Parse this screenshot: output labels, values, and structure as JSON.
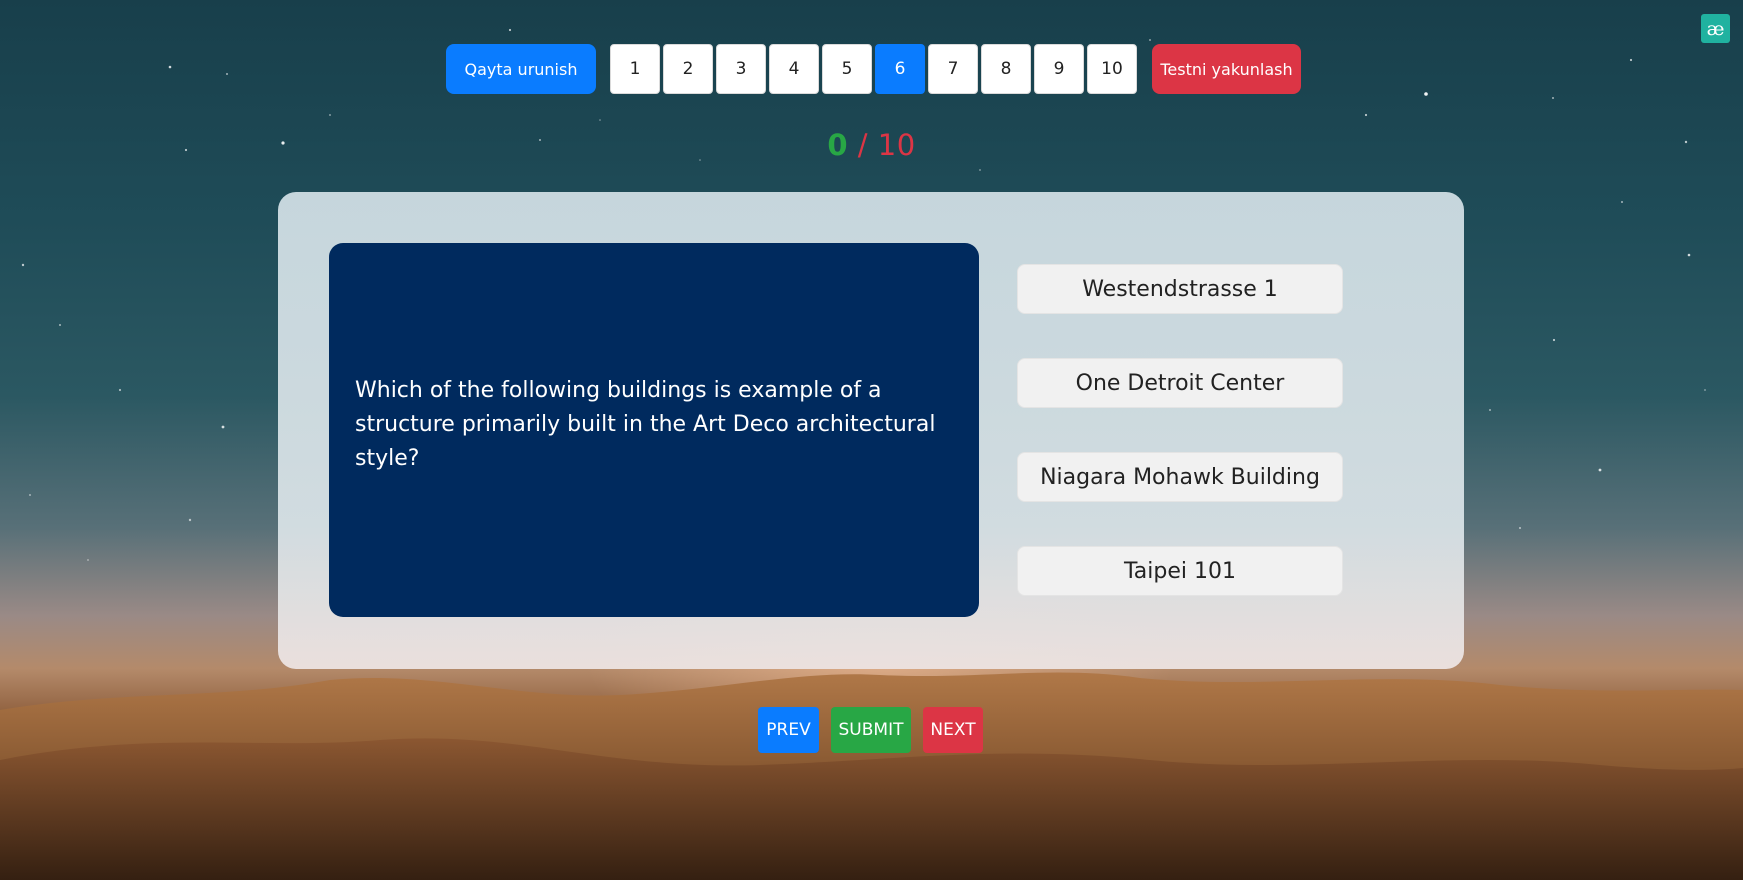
{
  "header": {
    "retry_label": "Qayta urunish",
    "finish_label": "Testni yakunlash",
    "pages": [
      "1",
      "2",
      "3",
      "4",
      "5",
      "6",
      "7",
      "8",
      "9",
      "10"
    ],
    "active_page": "6"
  },
  "score": {
    "correct": "0",
    "separator": "/",
    "total": "10"
  },
  "question": {
    "text": "Which of the following buildings is example of a structure primarily built in the Art Deco architectural style?"
  },
  "answers": [
    "Westendstrasse 1",
    "One Detroit Center",
    "Niagara Mohawk Building",
    "Taipei 101"
  ],
  "nav": {
    "prev_label": "PREV",
    "submit_label": "SUBMIT",
    "next_label": "NEXT"
  },
  "logo": {
    "glyph": "æ"
  },
  "colors": {
    "primary": "#0a7cff",
    "success": "#28a745",
    "danger": "#dc3545",
    "question_bg": "#002a5e",
    "logo_bg": "#20b2a0"
  }
}
